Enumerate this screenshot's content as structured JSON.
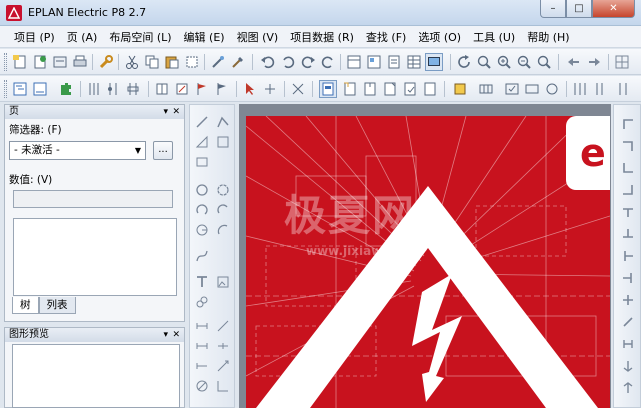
{
  "window": {
    "title": "EPLAN Electric P8 2.7",
    "controls": [
      "–",
      "□",
      "✕"
    ]
  },
  "menu": [
    "项目 (P)",
    "页 (A)",
    "布局空间 (L)",
    "编辑 (E)",
    "视图 (V)",
    "项目数据 (R)",
    "查找 (F)",
    "选项 (O)",
    "工具 (U)",
    "帮助 (H)"
  ],
  "page_panel": {
    "title": "页",
    "filter_label": "筛选器: (F)",
    "filter_value": "- 未激活 -",
    "more_button": "...",
    "value_label": "数值: (V)",
    "value": "",
    "tabs": [
      "树",
      "列表"
    ],
    "active_tab": "树"
  },
  "preview_panel": {
    "title": "图形预览"
  },
  "splash": {
    "brand_letter": "e",
    "watermark_main": "极夏网",
    "watermark_url": "www.jixiaw.com"
  },
  "colors": {
    "brand_red": "#c8121e",
    "titlebar": "#c4d6ec",
    "close_button": "#c6452c"
  },
  "icons": {
    "toolbar1": [
      "new-project-icon",
      "open-project-icon",
      "print-icon",
      "print-preview-icon",
      "wrench-icon",
      "cut-icon",
      "copy-icon",
      "paste-icon",
      "delete-icon",
      "paint-icon",
      "brush-icon",
      "undo-icon",
      "undo-list-icon",
      "redo-icon",
      "redo-list-icon",
      "page-icon",
      "report-icon",
      "form-icon",
      "table-icon",
      "monitor-icon",
      "refresh-icon",
      "zoom-window-icon",
      "zoom-in-icon",
      "zoom-out-icon",
      "zoom-all-icon",
      "back-icon",
      "forward-icon"
    ],
    "toolbar2": [
      "navigator-icon",
      "device-icon",
      "plugin-icon",
      "terminal-icon",
      "cable-icon",
      "connector-icon",
      "pin-icon",
      "graphic-editor-icon",
      "flag-icon",
      "insert-icon",
      "arrow-icon",
      "mouse-icon",
      "macro-icon",
      "page-macro-icon",
      "symbol-icon",
      "window-macro-icon",
      "component-icon",
      "grid-icon",
      "layer-icon",
      "snap-icon",
      "property-icon",
      "measure-icon",
      "check-icon"
    ]
  }
}
